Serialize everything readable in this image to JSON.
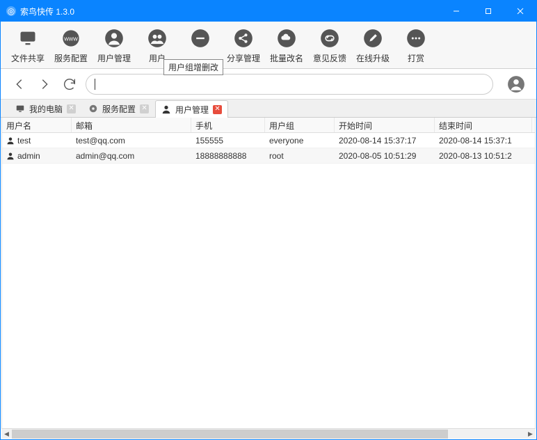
{
  "window": {
    "title": "索鸟快传 1.3.0"
  },
  "titlebar_icons": {
    "minimize": "—",
    "maximize": "▢",
    "close": "✕"
  },
  "toolbar": [
    {
      "name": "file-share",
      "label": "文件共享"
    },
    {
      "name": "service-config",
      "label": "服务配置"
    },
    {
      "name": "user-manage",
      "label": "用户管理"
    },
    {
      "name": "usergroup-manage",
      "label": "用户组增删改"
    },
    {
      "name": "share-manage",
      "label": "分享管理"
    },
    {
      "name": "batch-rename",
      "label": "批量改名"
    },
    {
      "name": "feedback",
      "label": "意见反馈"
    },
    {
      "name": "online-upgrade",
      "label": "在线升级"
    },
    {
      "name": "tip",
      "label": "打赏"
    }
  ],
  "toolbar_truncated": "用户",
  "tooltip": "用户组增删改",
  "address": "|",
  "tabs": [
    {
      "name": "tab-mycomputer",
      "label": "我的电脑",
      "active": false,
      "close_red": false
    },
    {
      "name": "tab-service-config",
      "label": "服务配置",
      "active": false,
      "close_red": false
    },
    {
      "name": "tab-user-manage",
      "label": "用户管理",
      "active": true,
      "close_red": true
    }
  ],
  "columns": {
    "user": "用户名",
    "email": "邮箱",
    "phone": "手机",
    "group": "用户组",
    "start": "开始时间",
    "end": "结束时间"
  },
  "rows": [
    {
      "user": "test",
      "email": "test@qq.com",
      "phone": "155555",
      "group": "everyone",
      "start": "2020-08-14 15:37:17",
      "end": "2020-08-14 15:37:1"
    },
    {
      "user": "admin",
      "email": "admin@qq.com",
      "phone": "18888888888",
      "group": "root",
      "start": "2020-08-05 10:51:29",
      "end": "2020-08-13 10:51:2"
    }
  ]
}
